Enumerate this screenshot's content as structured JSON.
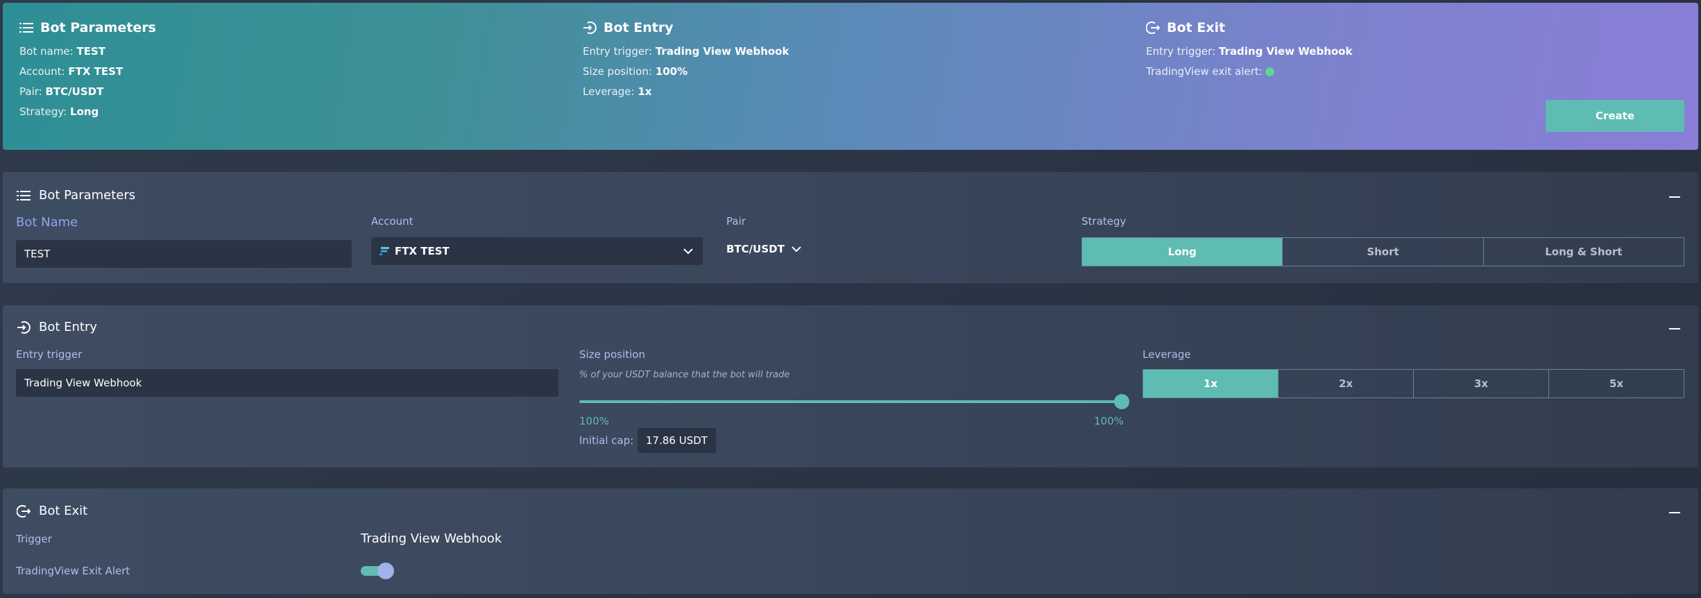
{
  "summary": {
    "params": {
      "title": "Bot Parameters",
      "name_label": "Bot name:",
      "name_value": "TEST",
      "account_label": "Account:",
      "account_value": "FTX TEST",
      "pair_label": "Pair:",
      "pair_value": "BTC/USDT",
      "strategy_label": "Strategy:",
      "strategy_value": "Long"
    },
    "entry": {
      "title": "Bot Entry",
      "trigger_label": "Entry trigger:",
      "trigger_value": "Trading View Webhook",
      "size_label": "Size position:",
      "size_value": "100%",
      "leverage_label": "Leverage:",
      "leverage_value": "1x"
    },
    "exit": {
      "title": "Bot Exit",
      "trigger_label": "Entry trigger:",
      "trigger_value": "Trading View Webhook",
      "alert_label": "TradingView exit alert:",
      "alert_status_color": "#5fd39a"
    },
    "create_label": "Create"
  },
  "params_panel": {
    "title": "Bot Parameters",
    "bot_name_label": "Bot Name",
    "bot_name_value": "TEST",
    "account_label": "Account",
    "account_value": "FTX TEST",
    "pair_label": "Pair",
    "pair_value": "BTC/USDT",
    "strategy_label": "Strategy",
    "strategy_options": [
      "Long",
      "Short",
      "Long & Short"
    ],
    "strategy_selected": "Long"
  },
  "entry_panel": {
    "title": "Bot Entry",
    "trigger_label": "Entry trigger",
    "trigger_value": "Trading View Webhook",
    "size_label": "Size position",
    "size_hint": "% of your USDT balance that the bot will trade",
    "size_min_label": "100%",
    "size_max_label": "100%",
    "size_value_fraction": 1.0,
    "initial_cap_label": "Initial cap:",
    "initial_cap_value": "17.86 USDT",
    "leverage_label": "Leverage",
    "leverage_options": [
      "1x",
      "2x",
      "3x",
      "5x"
    ],
    "leverage_selected": "1x"
  },
  "exit_panel": {
    "title": "Bot Exit",
    "trigger_label": "Trigger",
    "trigger_value": "Trading View Webhook",
    "alert_label": "TradingView Exit Alert",
    "alert_enabled": true
  },
  "colors": {
    "accent": "#5ebcb3",
    "label": "#aebfe8",
    "panel": "#3a475c"
  },
  "icons": [
    "list-icon",
    "entry-icon",
    "exit-icon",
    "chevron-down-icon",
    "ftx-logo-icon",
    "collapse-icon"
  ]
}
